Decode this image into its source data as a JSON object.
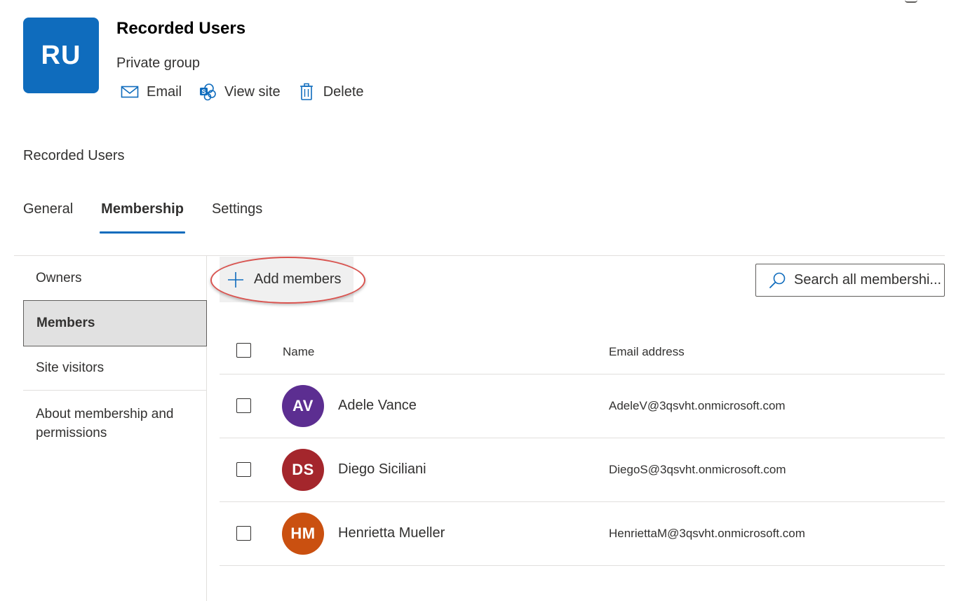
{
  "group": {
    "initials": "RU",
    "tile_color": "#0f6cbd",
    "title": "Recorded Users",
    "subtitle": "Private group"
  },
  "actions": [
    {
      "label": "Email",
      "icon": "mail-icon"
    },
    {
      "label": "View site",
      "icon": "sharepoint-icon"
    },
    {
      "label": "Delete",
      "icon": "trash-icon"
    }
  ],
  "breadcrumb": "Recorded Users",
  "tabs": [
    {
      "label": "General",
      "active": false
    },
    {
      "label": "Membership",
      "active": true
    },
    {
      "label": "Settings",
      "active": false
    }
  ],
  "side_nav": [
    {
      "label": "Owners",
      "selected": false
    },
    {
      "label": "Members",
      "selected": true
    },
    {
      "label": "Site visitors",
      "selected": false
    },
    {
      "label": "About membership and permissions",
      "selected": false
    }
  ],
  "toolbar": {
    "add_members_label": "Add members",
    "add_icon": "plus-icon"
  },
  "search": {
    "placeholder": "Search all membershi...",
    "icon": "search-icon"
  },
  "table": {
    "headers": {
      "name": "Name",
      "email": "Email address"
    },
    "rows": [
      {
        "initials": "AV",
        "name": "Adele Vance",
        "email": "AdeleV@3qsvht.onmicrosoft.com",
        "avatar_color": "#5c2e91"
      },
      {
        "initials": "DS",
        "name": "Diego Siciliani",
        "email": "DiegoS@3qsvht.onmicrosoft.com",
        "avatar_color": "#a4262c"
      },
      {
        "initials": "HM",
        "name": "Henrietta Mueller",
        "email": "HenriettaM@3qsvht.onmicrosoft.com",
        "avatar_color": "#ca5010"
      }
    ]
  },
  "colors": {
    "accent": "#0f6cbd",
    "highlight_ring": "#d9534f"
  }
}
